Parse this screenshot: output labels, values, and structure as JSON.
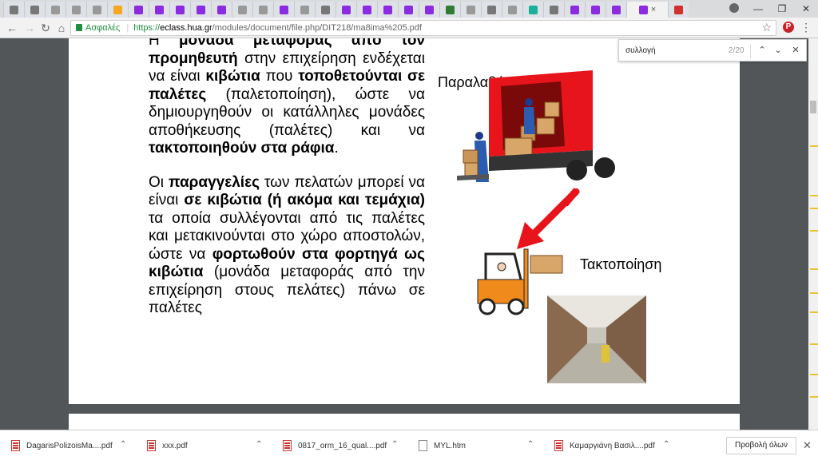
{
  "browser": {
    "tabs_count": 34,
    "active_tab_close": "×",
    "address": {
      "secure_label": "Ασφαλές",
      "scheme": "https://",
      "host": "eclass.hua.gr",
      "path": "/modules/document/file.php/DIT218/ma8ima%205.pdf"
    },
    "find": {
      "query": "συλλογή",
      "count": "2/20"
    }
  },
  "document": {
    "paragraph1": {
      "t1": "Η ",
      "b1": "μονάδα μεταφοράς από τον προμηθευτή",
      "t2": " στην επιχείρηση ενδέχεται να είναι ",
      "b2": "κιβώτια",
      "t3": " που ",
      "b3": "τοποθετούνται σε παλέτες",
      "t4": " (παλετοποίηση), ώστε να δημιουργηθούν οι κατάλληλες μονάδες αποθήκευσης (παλέτες) και να ",
      "b4": "τακτοποιηθούν στα ράφια",
      "t5": "."
    },
    "paragraph2": {
      "t1": "Οι ",
      "b1": "παραγγελίες",
      "t2": " των πελατών μπορεί να είναι ",
      "b2": "σε κιβώτια (ή ακόμα και τεμάχια)",
      "t3": " τα οποία συλλέγονται από τις παλέτες και μετακινούνται στο χώρο αποστολών, ώστε να ",
      "b3": "φορτωθούν στα φορτηγά ως κιβώτια",
      "t4": " (μονάδα μεταφοράς από την επιχείρηση στους πελάτες) πάνω σε παλέτες"
    },
    "label_receive": "Παραλαβή",
    "label_storage": "Τακτοποίηση"
  },
  "downloads": {
    "items": [
      {
        "name": "DagarisPolizoisMa....pdf",
        "type": "pdf"
      },
      {
        "name": "xxx.pdf",
        "type": "pdf"
      },
      {
        "name": "0817_orm_16_qual....pdf",
        "type": "pdf"
      },
      {
        "name": "MYL.htm",
        "type": "htm"
      },
      {
        "name": "Καμαργιάνη Βασιλ....pdf",
        "type": "pdf"
      }
    ],
    "show_all": "Προβολή όλων"
  },
  "colors": {
    "truck_red": "#e8141b",
    "forklift_orange": "#f08a1c",
    "find_highlight": "#e8c52d",
    "secure_green": "#1e8e3e"
  }
}
